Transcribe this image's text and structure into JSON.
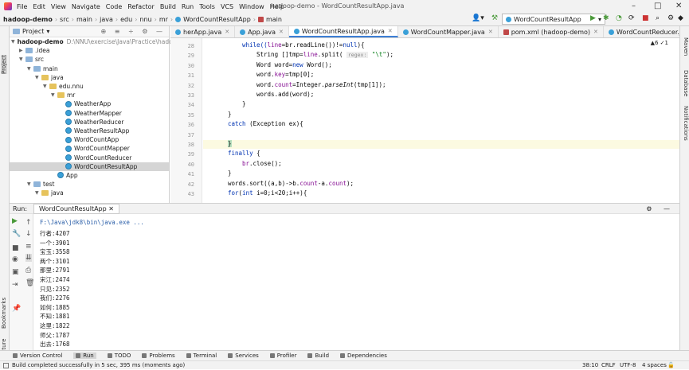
{
  "menu": {
    "items": [
      "File",
      "Edit",
      "View",
      "Navigate",
      "Code",
      "Refactor",
      "Build",
      "Run",
      "Tools",
      "VCS",
      "Window",
      "Help"
    ],
    "title": "hadoop-demo - WordCountResultApp.java"
  },
  "nav": {
    "crumbs": [
      "hadoop-demo",
      "src",
      "main",
      "java",
      "edu",
      "nnu",
      "mr",
      "WordCountResultApp",
      "main"
    ],
    "run_config": "WordCountResultApp"
  },
  "project": {
    "header": "Project",
    "root_label": "hadoop-demo",
    "root_path": "D:\\NNU\\exercise\\Java\\Practice\\hadoo",
    "rows": [
      {
        "label": ".idea",
        "kind": "folder"
      },
      {
        "label": "src",
        "kind": "folder"
      },
      {
        "label": "main",
        "kind": "folder"
      },
      {
        "label": "java",
        "kind": "folder"
      },
      {
        "label": "edu.nnu",
        "kind": "folder"
      },
      {
        "label": "mr",
        "kind": "folder"
      },
      {
        "label": "WeatherApp",
        "kind": "class"
      },
      {
        "label": "WeatherMapper",
        "kind": "class"
      },
      {
        "label": "WeatherReducer",
        "kind": "class"
      },
      {
        "label": "WeatherResultApp",
        "kind": "class"
      },
      {
        "label": "WordCountApp",
        "kind": "class"
      },
      {
        "label": "WordCountMapper",
        "kind": "class"
      },
      {
        "label": "WordCountReducer",
        "kind": "class"
      },
      {
        "label": "WordCountResultApp",
        "kind": "class"
      },
      {
        "label": "App",
        "kind": "class"
      },
      {
        "label": "test",
        "kind": "folder"
      },
      {
        "label": "java",
        "kind": "folder"
      }
    ]
  },
  "tabs": [
    "herApp.java",
    "App.java",
    "WordCountResultApp.java",
    "WordCountMapper.java",
    "pom.xml (hadoop-demo)",
    "WordCountReducer.java",
    "AppTest.ja"
  ],
  "editor": {
    "inspection": "▲6 ✓1",
    "lines": [
      {
        "n": "28"
      },
      {
        "n": "29"
      },
      {
        "n": "30"
      },
      {
        "n": "31"
      },
      {
        "n": "32"
      },
      {
        "n": "33"
      },
      {
        "n": "34"
      },
      {
        "n": "35"
      },
      {
        "n": "36"
      },
      {
        "n": "37"
      },
      {
        "n": "38"
      },
      {
        "n": "39"
      },
      {
        "n": "40"
      },
      {
        "n": "41"
      },
      {
        "n": "42"
      },
      {
        "n": "43"
      }
    ],
    "code": {
      "l28a": "while((",
      "l28b": "line",
      "l28c": "=br.readLine())!=",
      "l28d": "null",
      "l28e": "){",
      "l29a": "String []tmp=",
      "l29b": "line",
      "l29c": ".split( ",
      "l29d": "regex:",
      "l29e": " \"\\t\"",
      ".": "",
      "l29f": ");",
      "l30a": "Word word=",
      "l30b": "new",
      "l30c": " Word();",
      "l31a": "word.",
      "l31b": "key",
      "l31c": "=tmp[0];",
      "l32a": "word.",
      "l32b": "count",
      "l32c": "=Integer.",
      "l32d": "parseInt",
      "l32e": "(tmp[1]);",
      "l33": "words.add(word);",
      "l34": "}",
      "l35": "}",
      "l36a": "catch",
      "l36b": " (Exception ex){",
      "l37": "",
      "l38": "}",
      "l39a": "finally",
      "l39b": " {",
      "l40a": "br",
      "l40b": ".close();",
      "l41": "}",
      "l42a": "words.sort((a,b)->b.",
      "l42b": "count",
      "l42c": "-a.",
      "l42d": "count",
      "l42e": ");",
      "l43a": "for",
      "l43b": "(",
      "l43c": "int",
      "l43d": " i=0;i<20;i++){"
    }
  },
  "run": {
    "label": "Run:",
    "tab": "WordCountResultApp",
    "cmd": "F:\\Java\\jdk8\\bin\\java.exe ...",
    "output": [
      "行者:4207",
      "一个:3901",
      "宝玉:3558",
      "两个:3101",
      "那里:2791",
      "宋江:2474",
      "只见:2352",
      "我们:2276",
      "如何:1885",
      "不知:1881",
      "这里:1822",
      "师父:1787",
      "出去:1768"
    ]
  },
  "toolwindows": [
    "Version Control",
    "Run",
    "TODO",
    "Problems",
    "Terminal",
    "Services",
    "Profiler",
    "Build",
    "Dependencies"
  ],
  "status": {
    "message": "Build completed successfully in 5 sec, 395 ms (moments ago)",
    "pos": "38:10",
    "eol": "CRLF",
    "enc": "UTF-8",
    "indent": "4 spaces"
  },
  "side": {
    "project": "Project",
    "bookmarks": "Bookmarks",
    "structure": "Structure",
    "maven": "Maven",
    "database": "Database",
    "notifications": "Notifications"
  }
}
